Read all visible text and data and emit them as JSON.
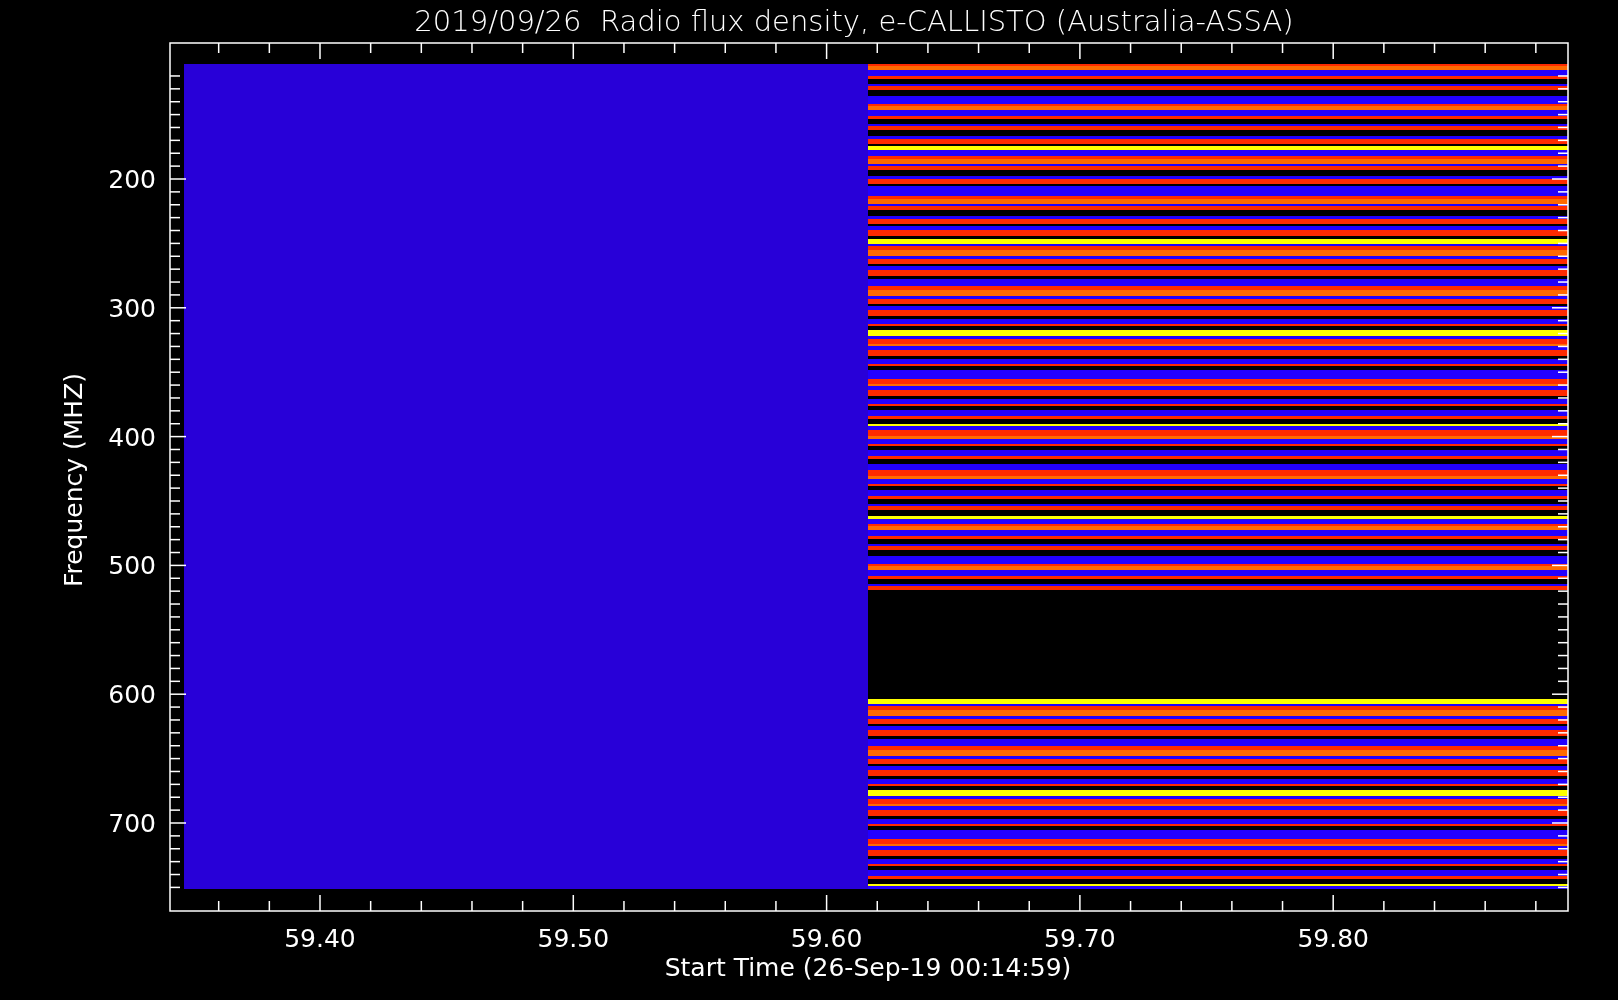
{
  "title": "2019/09/26  Radio flux density, e-CALLISTO (Australia-ASSA)",
  "plot": {
    "ylabel": "Frequency (MHZ)",
    "xlabel": "Start Time (26-Sep-19 00:14:59)",
    "yticks": [
      "200",
      "300",
      "400",
      "500",
      "600",
      "700"
    ],
    "xticks": [
      "59.40",
      "59.50",
      "59.60",
      "59.70",
      "59.80"
    ]
  }
}
